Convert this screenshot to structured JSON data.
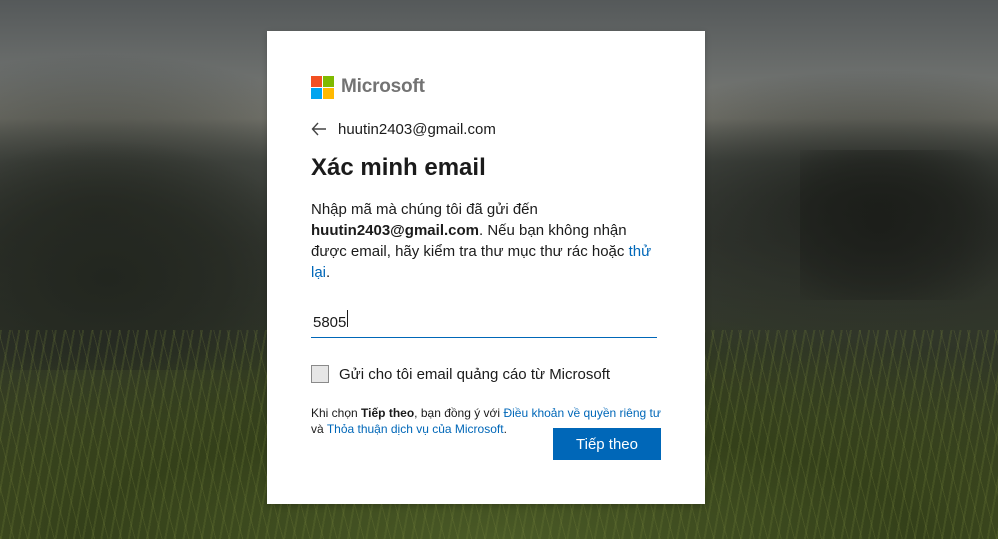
{
  "logo": {
    "text": "Microsoft",
    "colors": [
      "#f25022",
      "#7fba00",
      "#00a4ef",
      "#ffb900"
    ]
  },
  "identity": {
    "email": "huutin2403@gmail.com",
    "back_icon": "arrow-left-icon"
  },
  "title": "Xác minh email",
  "description": {
    "prefix": "Nhập mã mà chúng tôi đã gửi đến",
    "email": "huutin2403@gmail.com",
    "middle": ". Nếu bạn không nhận được email, hãy kiểm tra thư mục thư rác hoặc",
    "retry_link": "thử lại",
    "suffix": "."
  },
  "code_input": {
    "value": "5805",
    "placeholder": ""
  },
  "marketing_checkbox": {
    "label": "Gửi cho tôi email quảng cáo từ Microsoft",
    "checked": false
  },
  "terms": {
    "prefix": "Khi chọn",
    "button_ref": "Tiếp theo",
    "middle": ", bạn đồng ý với",
    "privacy_link": "Điều khoản về quyền riêng tư",
    "and": "và",
    "services_link": "Thỏa thuận dịch vụ của Microsoft",
    "suffix": "."
  },
  "actions": {
    "next_label": "Tiếp theo"
  },
  "colors": {
    "accent": "#0067b8",
    "text": "#1b1b1b"
  }
}
